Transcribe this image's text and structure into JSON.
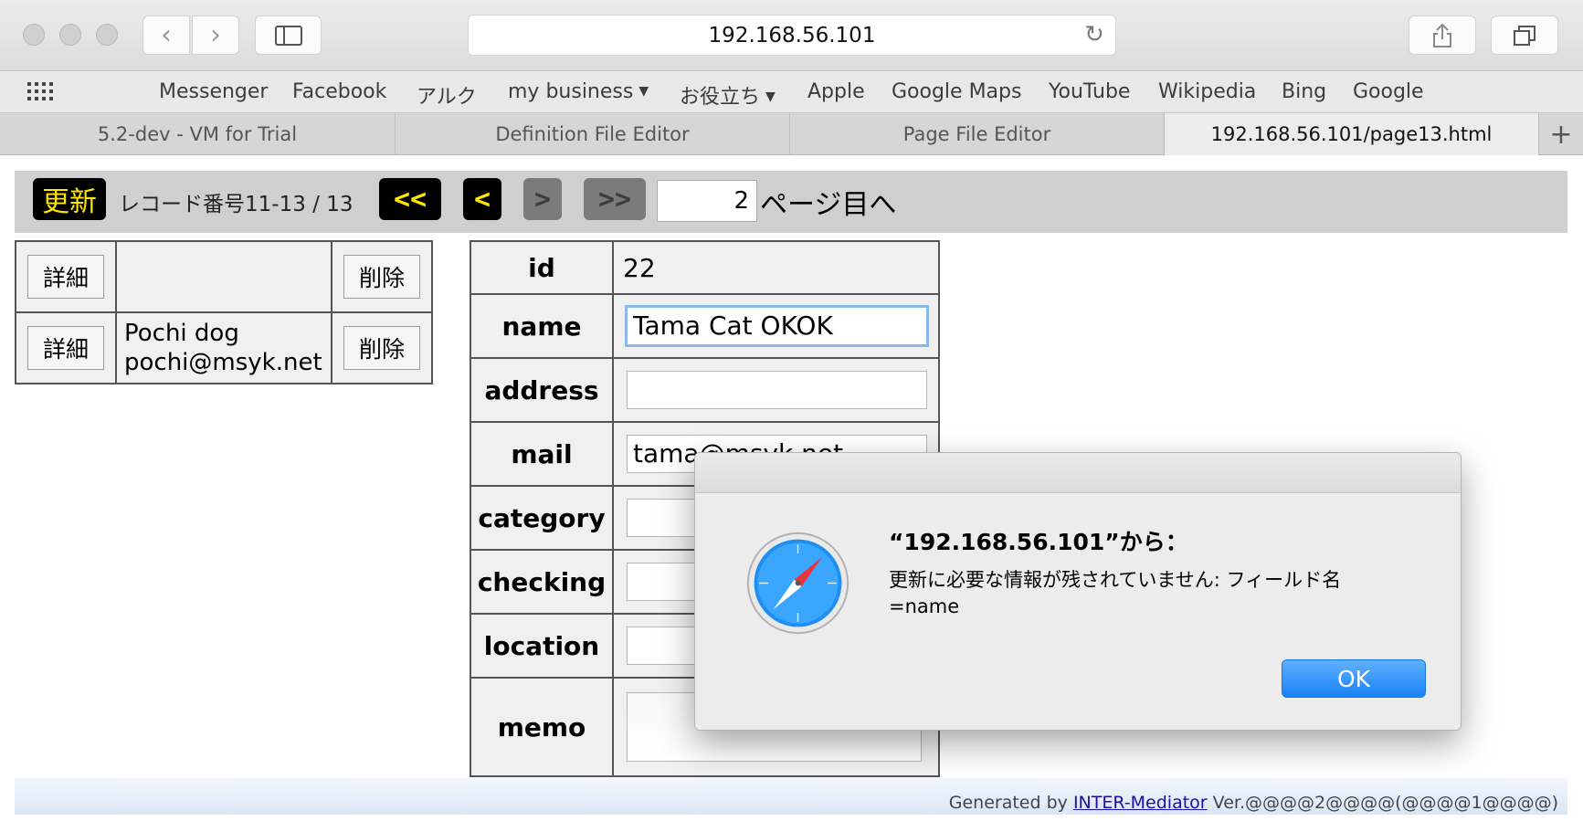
{
  "browser": {
    "url": "192.168.56.101",
    "bookmarks": [
      "Messenger",
      "Facebook",
      "アルク",
      "my business",
      "お役立ち",
      "Apple",
      "Google Maps",
      "YouTube",
      "Wikipedia",
      "Bing",
      "Google"
    ],
    "tabs": [
      "5.2-dev - VM for Trial",
      "Definition File Editor",
      "Page File Editor",
      "192.168.56.101/page13.html"
    ],
    "new_tab_label": "+"
  },
  "navigator": {
    "update_label": "更新",
    "record_info": "レコード番号11-13 / 13",
    "first_label": "<<",
    "prev_label": "<",
    "next_label": ">",
    "last_label": ">>",
    "page_value": "2",
    "page_suffix": "ページ目へ"
  },
  "list": {
    "detail_label": "詳細",
    "delete_label": "削除",
    "rows": [
      {
        "name": "",
        "email": ""
      },
      {
        "name": "Pochi dog",
        "email": "pochi@msyk.net"
      }
    ]
  },
  "detail": {
    "labels": {
      "id": "id",
      "name": "name",
      "address": "address",
      "mail": "mail",
      "category": "category",
      "checking": "checking",
      "location": "location",
      "memo": "memo"
    },
    "values": {
      "id": "22",
      "name": "Tama Cat OKOK",
      "address": "",
      "mail": "tama@msyk.net",
      "category": "",
      "checking": "",
      "location": "",
      "memo": ""
    }
  },
  "footer": {
    "prefix": "Generated by",
    "link": "INTER-Mediator",
    "suffix": "Ver.@@@@2@@@@(@@@@1@@@@)"
  },
  "dialog": {
    "title": "“192.168.56.101”から：",
    "message": "更新に必要な情報が残されていません: フィールド名=name",
    "ok_label": "OK"
  }
}
